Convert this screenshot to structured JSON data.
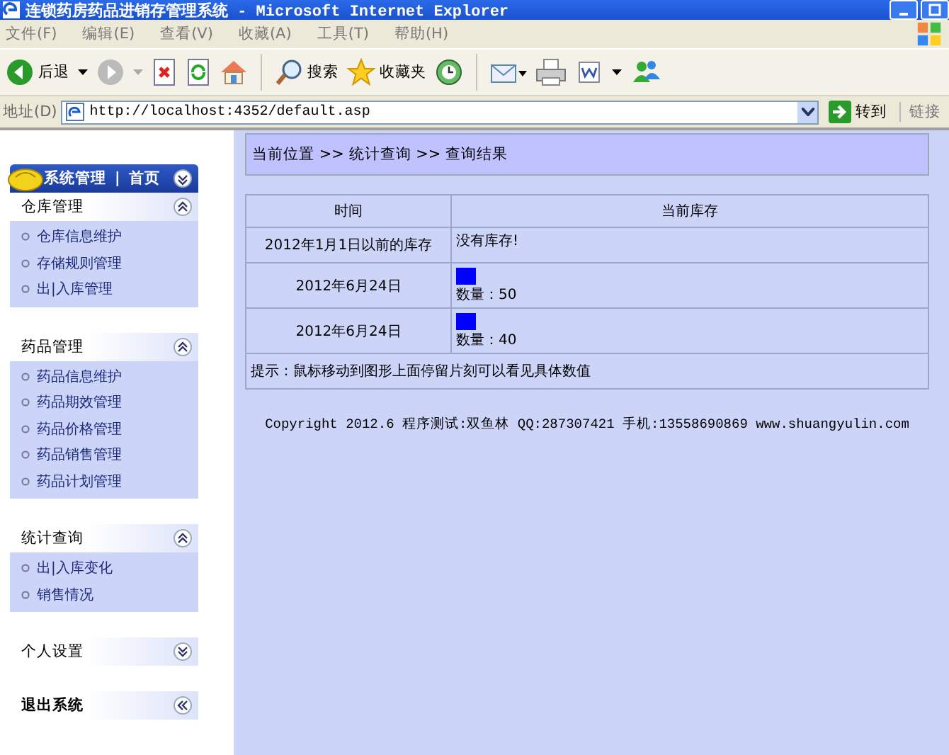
{
  "window": {
    "title": "连锁药房药品进销存管理系统 - Microsoft Internet Explorer"
  },
  "menu": [
    "文件(F)",
    "编辑(E)",
    "查看(V)",
    "收藏(A)",
    "工具(T)",
    "帮助(H)"
  ],
  "toolbar": {
    "back": "后退",
    "search": "搜索",
    "favorites": "收藏夹"
  },
  "address": {
    "label": "地址(D)",
    "url": "http://localhost:4352/default.asp",
    "go": "转到",
    "links": "链接"
  },
  "sidebar": {
    "title": "系统管理",
    "separator": "|",
    "home": "首页",
    "groups": [
      {
        "kind": "group",
        "title": "仓库管理",
        "expanded": true,
        "items": [
          "仓库信息维护",
          "存储规则管理",
          "出|入库管理"
        ]
      },
      {
        "kind": "group",
        "title": "药品管理",
        "expanded": true,
        "items": [
          "药品信息维护",
          "药品期效管理",
          "药品价格管理",
          "药品销售管理",
          "药品计划管理"
        ]
      },
      {
        "kind": "group",
        "title": "统计查询",
        "expanded": true,
        "items": [
          "出|入库变化",
          "销售情况"
        ]
      },
      {
        "kind": "group",
        "title": "个人设置",
        "expanded": false
      },
      {
        "kind": "exit",
        "title": "退出系统"
      }
    ]
  },
  "breadcrumb": "当前位置 >> 统计查询 >> 查询结果",
  "table": {
    "columns": [
      "时间",
      "当前库存"
    ],
    "rows": [
      {
        "kind": "text",
        "time": "2012年1月1日以前的库存",
        "stock": "没有库存!"
      },
      {
        "kind": "bar",
        "time": "2012年6月24日",
        "stock": "数量：50"
      },
      {
        "kind": "bar",
        "time": "2012年6月24日",
        "stock": "数量：40"
      }
    ],
    "hint": "提示：鼠标移动到图形上面停留片刻可以看见具体数值"
  },
  "footer": "Copyright 2012.6 程序测试:双鱼林 QQ:287307421 手机:13558690869 www.shuangyulin.com"
}
